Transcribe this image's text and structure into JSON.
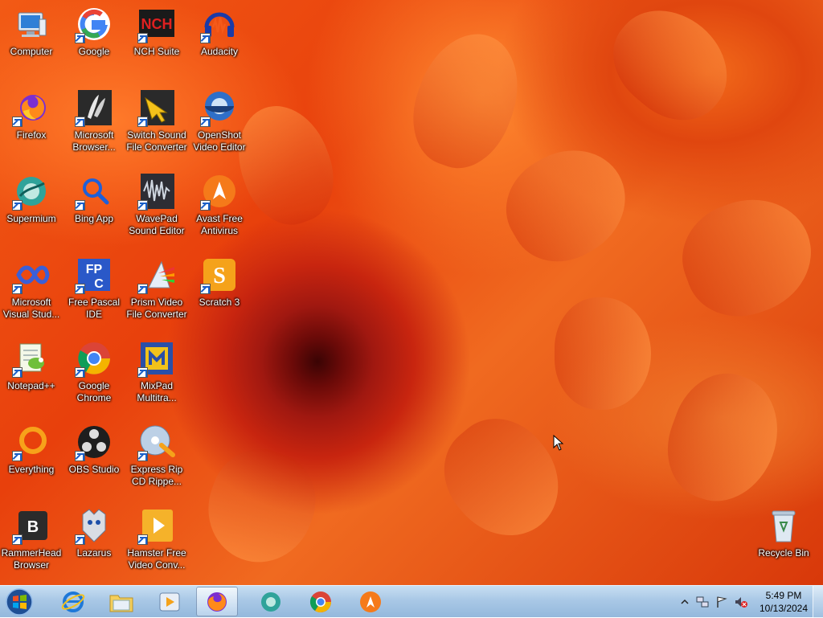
{
  "desktop": {
    "icons": [
      {
        "label": "Computer",
        "icon": "computer-icon"
      },
      {
        "label": "Google",
        "icon": "google-icon"
      },
      {
        "label": "NCH Suite",
        "icon": "nch-suite-icon"
      },
      {
        "label": "Audacity",
        "icon": "audacity-icon"
      },
      {
        "label": "Firefox",
        "icon": "firefox-icon"
      },
      {
        "label": "Microsoft\nBrowser...",
        "icon": "microsoft-browser-icon"
      },
      {
        "label": "Switch Sound\nFile Converter",
        "icon": "switch-sound-icon"
      },
      {
        "label": "OpenShot\nVideo Editor",
        "icon": "openshot-icon"
      },
      {
        "label": "Supermium",
        "icon": "supermium-icon"
      },
      {
        "label": "Bing App",
        "icon": "bing-app-icon"
      },
      {
        "label": "WavePad\nSound Editor",
        "icon": "wavepad-icon"
      },
      {
        "label": "Avast Free\nAntivirus",
        "icon": "avast-icon"
      },
      {
        "label": "Microsoft\nVisual Stud...",
        "icon": "visual-studio-icon"
      },
      {
        "label": "Free Pascal\nIDE",
        "icon": "free-pascal-icon"
      },
      {
        "label": "Prism Video\nFile Converter",
        "icon": "prism-icon"
      },
      {
        "label": "Scratch 3",
        "icon": "scratch-icon"
      },
      {
        "label": "Notepad++",
        "icon": "notepadpp-icon"
      },
      {
        "label": "Google\nChrome",
        "icon": "chrome-icon"
      },
      {
        "label": "MixPad\nMultitra...",
        "icon": "mixpad-icon"
      },
      {
        "label": "Everything",
        "icon": "everything-icon"
      },
      {
        "label": "OBS Studio",
        "icon": "obs-icon"
      },
      {
        "label": "Express Rip\nCD Rippe...",
        "icon": "express-rip-icon"
      },
      {
        "label": "RammerHead\nBrowser",
        "icon": "rammerhead-icon"
      },
      {
        "label": "Lazarus",
        "icon": "lazarus-icon"
      },
      {
        "label": "Hamster Free\nVideo Conv...",
        "icon": "hamster-icon"
      },
      {
        "label": "Recycle Bin",
        "icon": "recycle-bin-icon"
      }
    ]
  },
  "taskbar": {
    "pinned": [
      {
        "name": "internet-explorer-icon"
      },
      {
        "name": "file-explorer-icon"
      },
      {
        "name": "media-player-icon"
      },
      {
        "name": "firefox-taskbar-icon",
        "active": true
      },
      {
        "name": "supermium-taskbar-icon"
      },
      {
        "name": "chrome-taskbar-icon"
      },
      {
        "name": "avast-taskbar-icon"
      }
    ],
    "clock": {
      "time": "5:49 PM",
      "date": "10/13/2024"
    }
  }
}
